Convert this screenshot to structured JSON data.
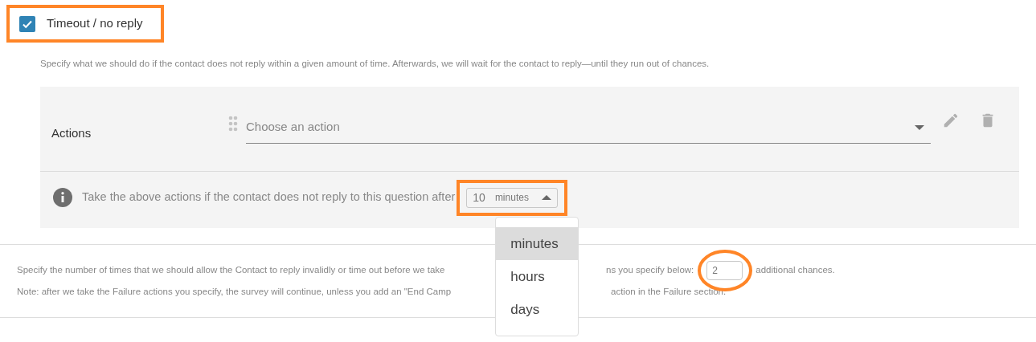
{
  "timeout_option": {
    "label": "Timeout / no reply",
    "checked": true
  },
  "description": "Specify what we should do if the contact does not reply within a given amount of time. Afterwards, we will wait for the contact to reply—until they run out of chances.",
  "actions": {
    "label": "Actions",
    "select": {
      "placeholder": "Choose an action"
    }
  },
  "wait_row": {
    "text": "Take the above actions if the contact does not reply to this question after",
    "amount": "10",
    "unit": "minutes",
    "expanded": true
  },
  "unit_menu": [
    {
      "label": "minutes",
      "selected": true
    },
    {
      "label": "hours",
      "selected": false
    },
    {
      "label": "days",
      "selected": false
    }
  ],
  "chances": {
    "line_1": [
      "Specify the number of times that we should allow the Contact to reply invalidly or time out before we take",
      "ns you specify below:",
      "additional chances."
    ],
    "value": "2",
    "note": [
      "Note: after we take the Failure actions you specify, the survey will continue, unless you add an \"End Camp",
      "action in the Failure section."
    ]
  }
}
